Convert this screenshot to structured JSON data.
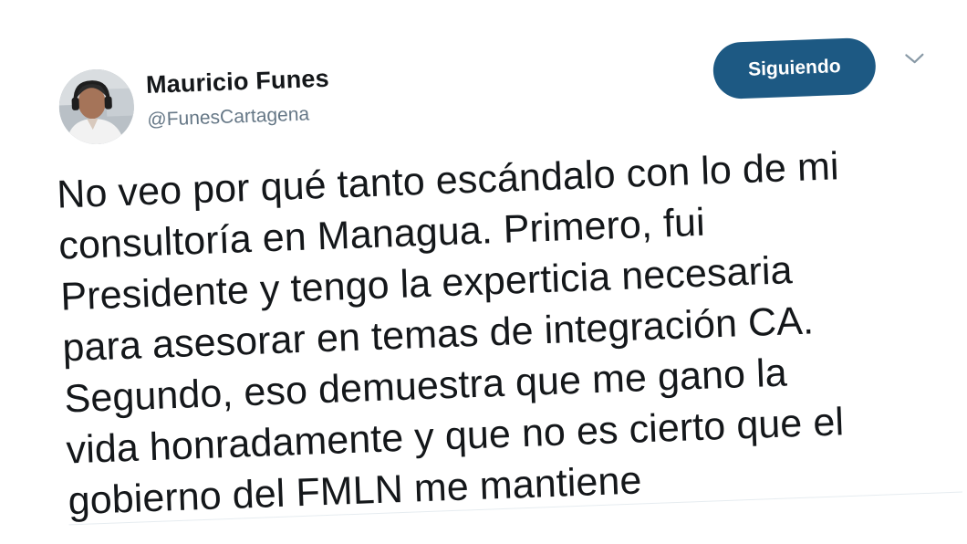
{
  "tweet": {
    "author": {
      "name": "Mauricio Funes",
      "handle": "@FunesCartagena",
      "avatar_icon": "user-avatar-photo"
    },
    "follow_button_label": "Siguiendo",
    "menu_icon": "chevron-down-icon",
    "text_lines": [
      "No veo por qué tanto escándalo con lo de mi",
      "consultoría en Managua. Primero, fui",
      "Presidente y tengo la experticia necesaria",
      "para asesorar en temas de integración CA.",
      "Segundo, eso demuestra que me gano la",
      "vida honradamente y que no es cierto que el",
      "gobierno del FMLN me mantiene"
    ]
  },
  "colors": {
    "follow_button_bg": "#1d5983",
    "text": "#14171a",
    "handle": "#657786",
    "divider": "#e6ecf0"
  }
}
